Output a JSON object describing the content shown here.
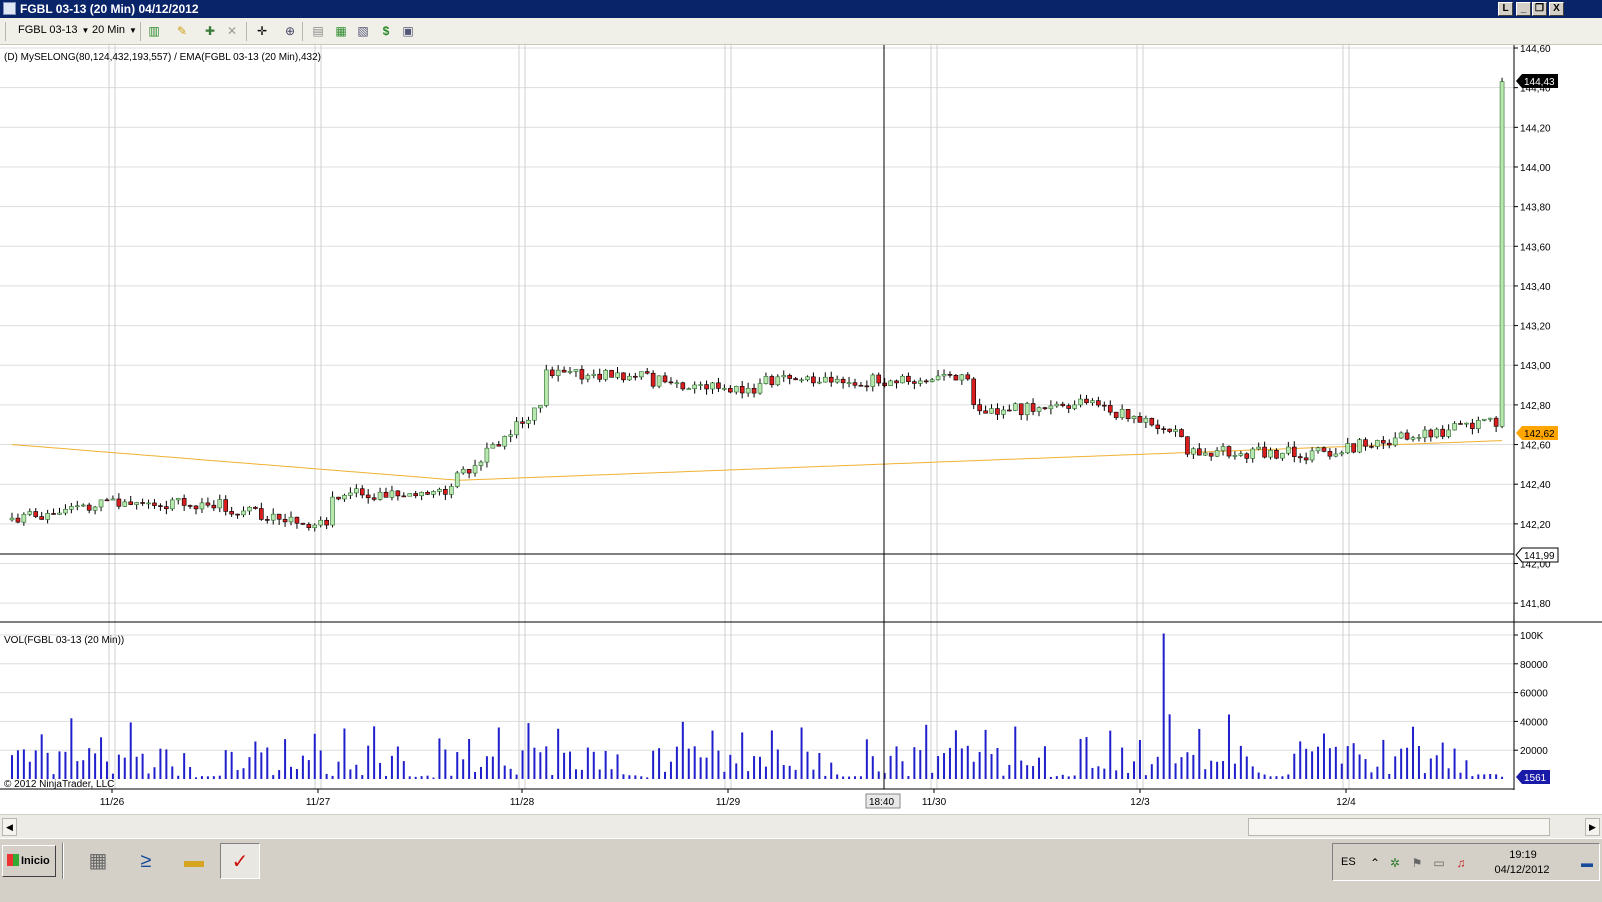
{
  "window": {
    "title": "FGBL 03-13 (20 Min)  04/12/2012",
    "buttons": [
      "L",
      "_",
      "❐",
      "X"
    ]
  },
  "toolbar": {
    "instrument": "FGBL 03-13",
    "interval": "20 Min",
    "icons": [
      "chart-style-icon",
      "drawing-pencil-icon",
      "add-indicator-icon",
      "remove-indicator-icon",
      "crosshair-icon",
      "zoom-icon",
      "properties-icon",
      "bar-chart-icon",
      "line-chart-icon",
      "dollar-icon",
      "panel-icon"
    ]
  },
  "price_panel": {
    "indicator_label": "(D) MySELONG(80,124,432,193,557) / EMA(FGBL 03-13 (20 Min),432)",
    "axis_ticks": [
      "144,60",
      "144,40",
      "144,20",
      "144,00",
      "143,80",
      "143,60",
      "143,40",
      "143,20",
      "143,00",
      "142,80",
      "142,60",
      "142,40",
      "142,20",
      "142,00",
      "141,80"
    ],
    "last_price": "144,43",
    "ema_value": "142,62",
    "crosshair_price": "141,99"
  },
  "volume_panel": {
    "label": "VOL(FGBL 03-13 (20 Min))",
    "axis_ticks": [
      "100K",
      "80000",
      "60000",
      "40000",
      "20000"
    ],
    "last_volume": "1561",
    "copyright": "© 2012 NinjaTrader, LLC"
  },
  "time_axis": {
    "labels": [
      "11/26",
      "11/27",
      "11/28",
      "11/29",
      "11/30",
      "12/3",
      "12/4"
    ],
    "crosshair_time": "18:40"
  },
  "taskbar": {
    "start_label": "Inicio",
    "language": "ES",
    "time": "19:19",
    "date": "04/12/2012"
  },
  "colors": {
    "up_candle": "#b8e8b0",
    "down_candle": "#d81e1e",
    "ema_line": "#f0b030",
    "volume_bars": "#1f1fcc",
    "last_price_tag": "#000000",
    "ema_tag": "#ffa500",
    "volume_tag": "#1a1aa8",
    "title_bar": "#0a246a"
  },
  "chart_data": {
    "type": "candlestick",
    "y_range": [
      141.7,
      144.6
    ],
    "volume_range": [
      0,
      100000
    ],
    "days": [
      "11/26",
      "11/27",
      "11/28",
      "11/29",
      "11/30",
      "12/3",
      "12/4"
    ],
    "approx_close_path": [
      {
        "session": "11/26",
        "open": 142.22,
        "close": 142.3,
        "high": 142.5,
        "low": 142.02
      },
      {
        "session": "11/27",
        "open": 142.28,
        "close": 142.35,
        "high": 142.4,
        "low": 141.86
      },
      {
        "session": "11/28",
        "open": 142.35,
        "close": 142.95,
        "high": 143.14,
        "low": 142.32
      },
      {
        "session": "11/29",
        "open": 142.92,
        "close": 142.92,
        "high": 143.02,
        "low": 142.64
      },
      {
        "session": "11/30",
        "open": 142.92,
        "close": 142.78,
        "high": 143.1,
        "low": 142.72
      },
      {
        "session": "12/3",
        "open": 142.82,
        "close": 142.56,
        "high": 143.04,
        "low": 142.08
      },
      {
        "session": "12/4",
        "open": 142.54,
        "close": 144.43,
        "high": 144.45,
        "low": 142.34
      }
    ],
    "ema_range": [
      142.42,
      142.62
    ],
    "volume_peak": 101000
  }
}
